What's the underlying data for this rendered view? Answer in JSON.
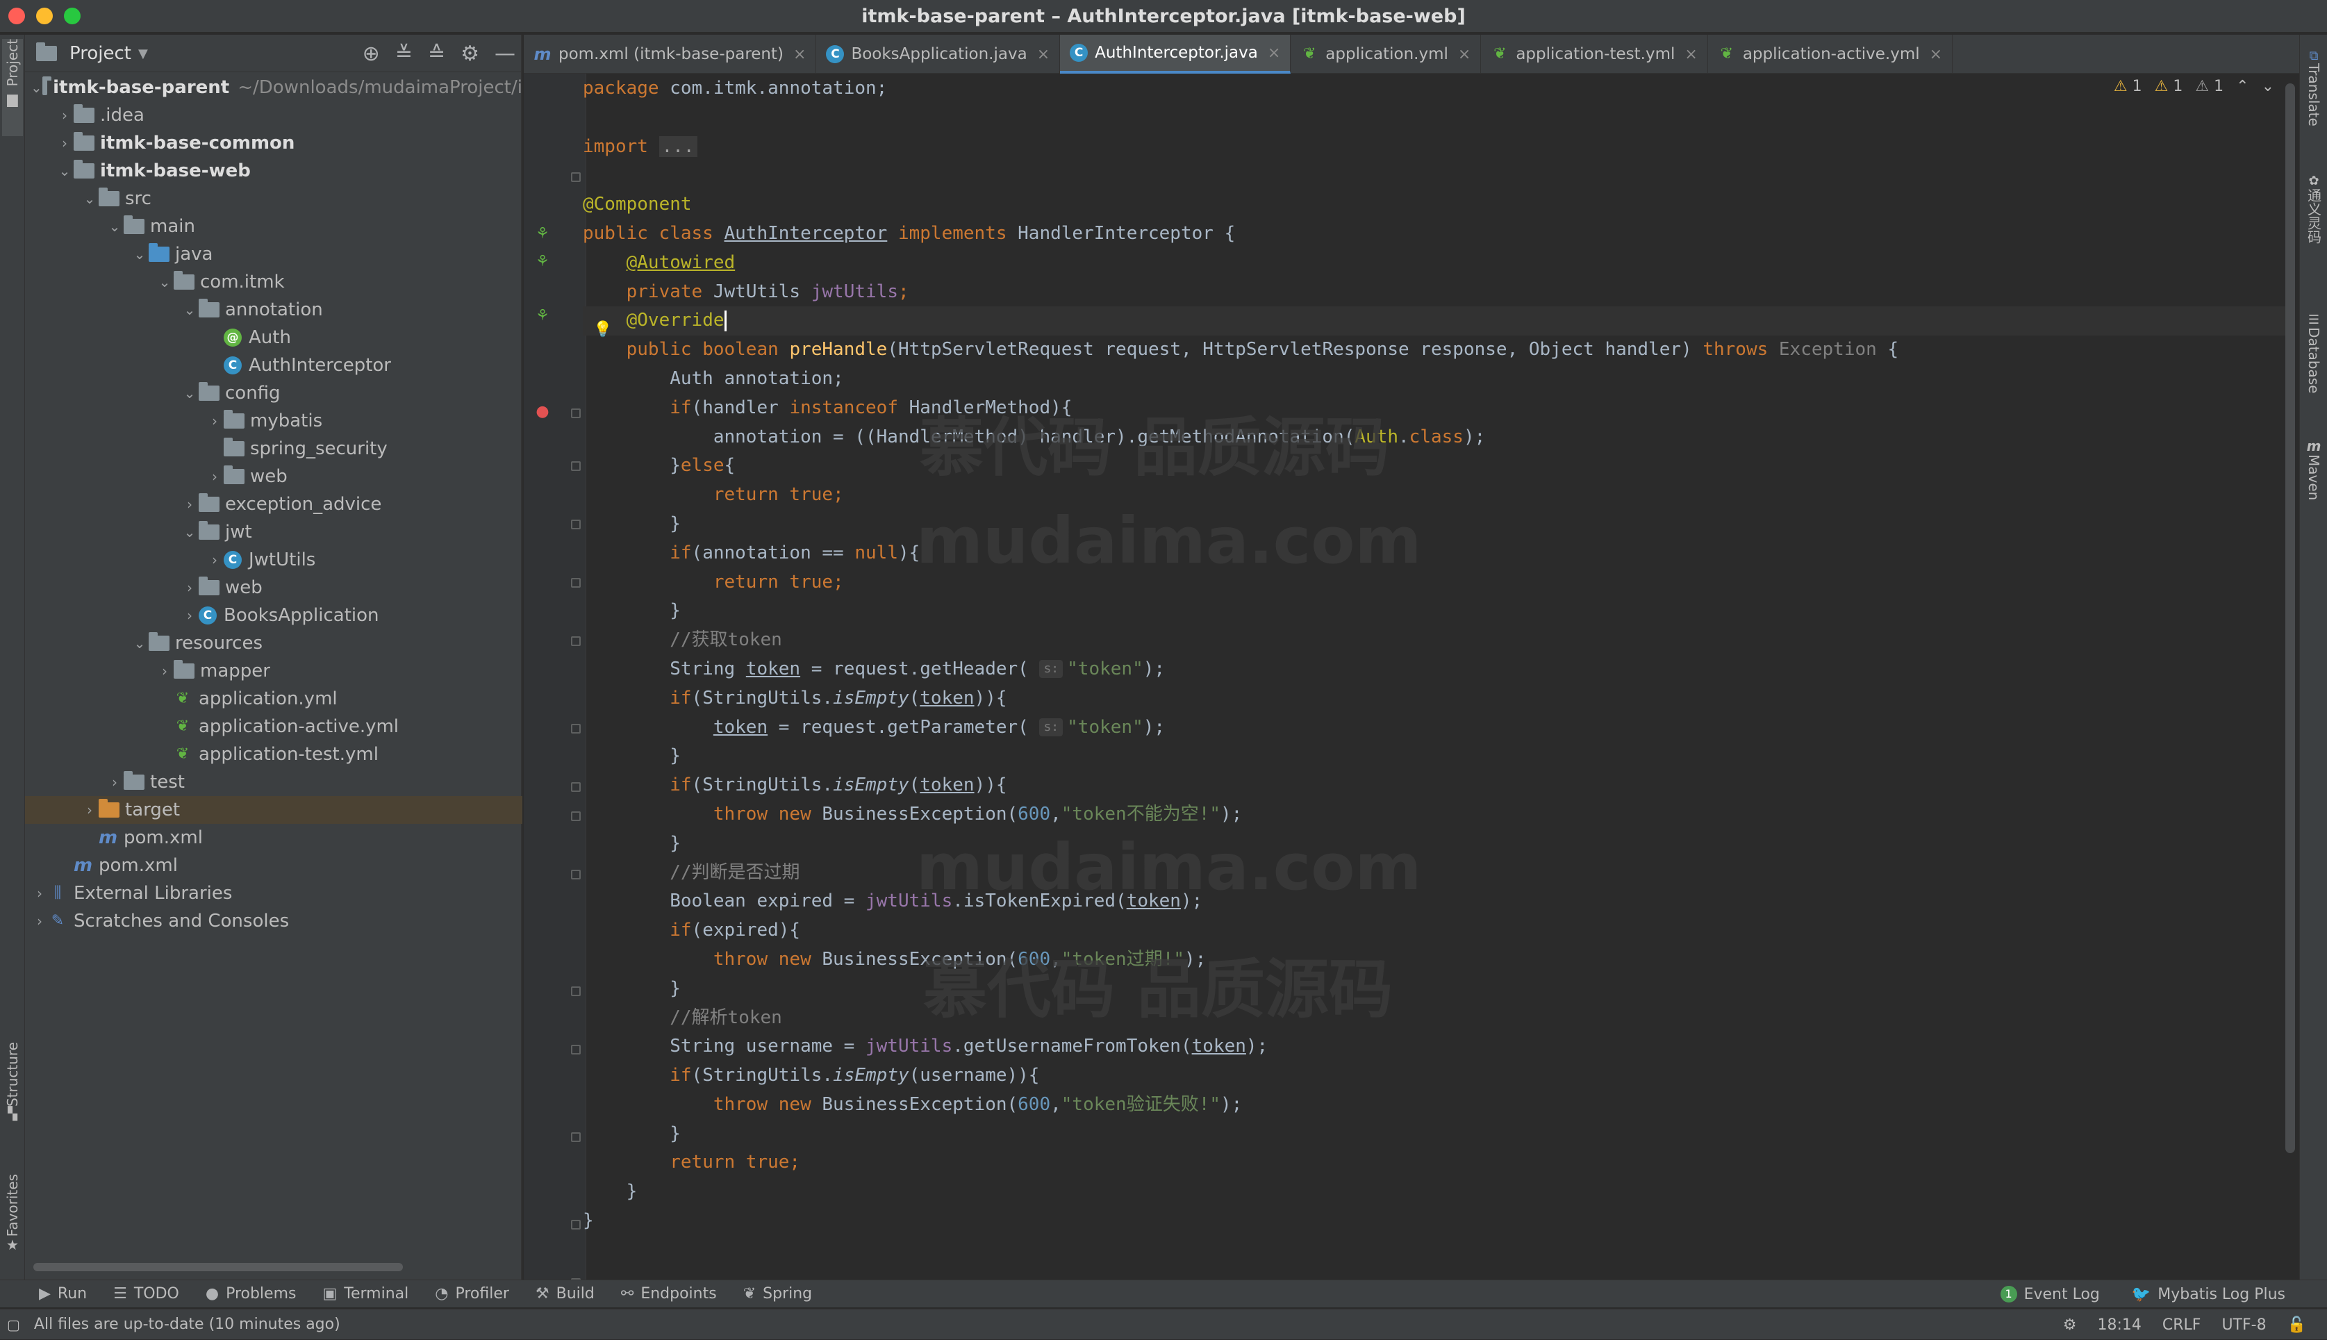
{
  "window": {
    "title": "itmk-base-parent – AuthInterceptor.java [itmk-base-web]",
    "traffic_colors": [
      "#ff5f57",
      "#febc2e",
      "#28c840"
    ]
  },
  "left_strip": {
    "project_label": "Project",
    "structure_label": "Structure",
    "favorites_label": "Favorites"
  },
  "right_strip": {
    "translate_label": "Translate",
    "tongyi_label": "通义灵码",
    "database_label": "Database",
    "maven_label": "Maven"
  },
  "project_panel": {
    "title": "Project",
    "items": [
      {
        "label": "itmk-base-parent",
        "hint": "~/Downloads/mudaimaProject/i",
        "bold": true,
        "depth": 0,
        "chev": "down",
        "kind": "module"
      },
      {
        "label": ".idea",
        "depth": 1,
        "chev": "right",
        "kind": "folder"
      },
      {
        "label": "itmk-base-common",
        "bold": true,
        "depth": 1,
        "chev": "right",
        "kind": "module"
      },
      {
        "label": "itmk-base-web",
        "bold": true,
        "depth": 1,
        "chev": "down",
        "kind": "module"
      },
      {
        "label": "src",
        "depth": 2,
        "chev": "down",
        "kind": "folder"
      },
      {
        "label": "main",
        "depth": 3,
        "chev": "down",
        "kind": "folder"
      },
      {
        "label": "java",
        "depth": 4,
        "chev": "down",
        "kind": "folder-blue"
      },
      {
        "label": "com.itmk",
        "depth": 5,
        "chev": "down",
        "kind": "folder"
      },
      {
        "label": "annotation",
        "depth": 6,
        "chev": "down",
        "kind": "folder"
      },
      {
        "label": "Auth",
        "depth": 7,
        "chev": "none",
        "kind": "annotation"
      },
      {
        "label": "AuthInterceptor",
        "depth": 7,
        "chev": "none",
        "kind": "class"
      },
      {
        "label": "config",
        "depth": 6,
        "chev": "down",
        "kind": "folder"
      },
      {
        "label": "mybatis",
        "depth": 7,
        "chev": "right",
        "kind": "folder"
      },
      {
        "label": "spring_security",
        "depth": 7,
        "chev": "none",
        "kind": "folder"
      },
      {
        "label": "web",
        "depth": 7,
        "chev": "right",
        "kind": "folder"
      },
      {
        "label": "exception_advice",
        "depth": 6,
        "chev": "right",
        "kind": "folder"
      },
      {
        "label": "jwt",
        "depth": 6,
        "chev": "down",
        "kind": "folder"
      },
      {
        "label": "JwtUtils",
        "depth": 7,
        "chev": "right",
        "kind": "class"
      },
      {
        "label": "web",
        "depth": 6,
        "chev": "right",
        "kind": "folder"
      },
      {
        "label": "BooksApplication",
        "depth": 6,
        "chev": "right",
        "kind": "boot"
      },
      {
        "label": "resources",
        "depth": 4,
        "chev": "down",
        "kind": "folder"
      },
      {
        "label": "mapper",
        "depth": 5,
        "chev": "right",
        "kind": "folder"
      },
      {
        "label": "application.yml",
        "depth": 5,
        "chev": "none",
        "kind": "yml"
      },
      {
        "label": "application-active.yml",
        "depth": 5,
        "chev": "none",
        "kind": "yml"
      },
      {
        "label": "application-test.yml",
        "depth": 5,
        "chev": "none",
        "kind": "yml"
      },
      {
        "label": "test",
        "depth": 3,
        "chev": "right",
        "kind": "folder"
      },
      {
        "label": "target",
        "depth": 2,
        "chev": "right",
        "kind": "folder-orange",
        "selected": true
      },
      {
        "label": "pom.xml",
        "depth": 2,
        "chev": "none",
        "kind": "maven"
      },
      {
        "label": "pom.xml",
        "depth": 1,
        "chev": "none",
        "kind": "maven"
      },
      {
        "label": "External Libraries",
        "depth": 0,
        "chev": "right",
        "kind": "libs"
      },
      {
        "label": "Scratches and Consoles",
        "depth": 0,
        "chev": "right",
        "kind": "scratch"
      }
    ]
  },
  "tabs": [
    {
      "label": "pom.xml (itmk-base-parent)",
      "icon": "maven",
      "active": false
    },
    {
      "label": "BooksApplication.java",
      "icon": "boot",
      "active": false
    },
    {
      "label": "AuthInterceptor.java",
      "icon": "class",
      "active": true
    },
    {
      "label": "application.yml",
      "icon": "yml",
      "active": false
    },
    {
      "label": "application-test.yml",
      "icon": "yml",
      "active": false
    },
    {
      "label": "application-active.yml",
      "icon": "yml",
      "active": false
    }
  ],
  "inspections": {
    "warn1": "1",
    "warn2": "1",
    "weak": "1"
  },
  "code_lines": [
    [
      [
        "kw",
        "package "
      ],
      [
        "t",
        "com.itmk.annotation;"
      ]
    ],
    [],
    [
      [
        "kw",
        "import "
      ],
      [
        "fold",
        "..."
      ]
    ],
    [],
    [
      [
        "an",
        "@Component"
      ]
    ],
    [
      [
        "kw",
        "public class "
      ],
      [
        "und",
        "AuthInterceptor"
      ],
      [
        "kw",
        " implements "
      ],
      [
        "t",
        "HandlerInterceptor {"
      ]
    ],
    [
      [
        "t",
        "    "
      ],
      [
        "an und",
        "@Autowired"
      ]
    ],
    [
      [
        "t",
        "    "
      ],
      [
        "kw",
        "private "
      ],
      [
        "t",
        "JwtUtils "
      ],
      [
        "fld",
        "jwtUtils"
      ],
      [
        "kw",
        ";"
      ]
    ],
    [
      [
        "t",
        "    "
      ],
      [
        "an",
        "@Override"
      ],
      [
        "caret",
        ""
      ]
    ],
    [
      [
        "t",
        "    "
      ],
      [
        "kw",
        "public boolean "
      ],
      [
        "mth",
        "preHandle"
      ],
      [
        "t",
        "(HttpServletRequest request, HttpServletResponse response, Object handler) "
      ],
      [
        "kw",
        "throws "
      ],
      [
        "cm",
        "Exception"
      ],
      [
        "t",
        " {"
      ]
    ],
    [
      [
        "t",
        "        Auth annotation;"
      ]
    ],
    [
      [
        "t",
        "        "
      ],
      [
        "kw",
        "if"
      ],
      [
        "t",
        "(handler "
      ],
      [
        "kw",
        "instanceof "
      ],
      [
        "t",
        "HandlerMethod){"
      ]
    ],
    [
      [
        "t",
        "            annotation = ((HandlerMethod) handler).getMethodAnnotation("
      ],
      [
        "an",
        "Auth"
      ],
      [
        "t",
        "."
      ],
      [
        "kw",
        "class"
      ],
      [
        "t",
        ");"
      ]
    ],
    [
      [
        "t",
        "        }"
      ],
      [
        "kw",
        "else"
      ],
      [
        "t",
        "{"
      ]
    ],
    [
      [
        "t",
        "            "
      ],
      [
        "kw",
        "return true;"
      ]
    ],
    [
      [
        "t",
        "        }"
      ]
    ],
    [
      [
        "t",
        "        "
      ],
      [
        "kw",
        "if"
      ],
      [
        "t",
        "(annotation == "
      ],
      [
        "kw",
        "null"
      ],
      [
        "t",
        "){"
      ]
    ],
    [
      [
        "t",
        "            "
      ],
      [
        "kw",
        "return true;"
      ]
    ],
    [
      [
        "t",
        "        }"
      ]
    ],
    [
      [
        "t",
        "        "
      ],
      [
        "cm",
        "//获取token"
      ]
    ],
    [
      [
        "t",
        "        String "
      ],
      [
        "und",
        "token"
      ],
      [
        "t",
        " = request.getHeader( "
      ],
      [
        "pill",
        "s:"
      ],
      [
        "str",
        "\"token\""
      ],
      [
        "t",
        ");"
      ]
    ],
    [
      [
        "t",
        "        "
      ],
      [
        "kw",
        "if"
      ],
      [
        "t",
        "(StringUtils."
      ],
      [
        "ital",
        "isEmpty"
      ],
      [
        "t",
        "("
      ],
      [
        "und",
        "token"
      ],
      [
        "t",
        ")){"
      ]
    ],
    [
      [
        "t",
        "            "
      ],
      [
        "und",
        "token"
      ],
      [
        "t",
        " = request.getParameter( "
      ],
      [
        "pill",
        "s:"
      ],
      [
        "str",
        "\"token\""
      ],
      [
        "t",
        ");"
      ]
    ],
    [
      [
        "t",
        "        }"
      ]
    ],
    [
      [
        "t",
        "        "
      ],
      [
        "kw",
        "if"
      ],
      [
        "t",
        "(StringUtils."
      ],
      [
        "ital",
        "isEmpty"
      ],
      [
        "t",
        "("
      ],
      [
        "und",
        "token"
      ],
      [
        "t",
        ")){"
      ]
    ],
    [
      [
        "t",
        "            "
      ],
      [
        "kw",
        "throw new "
      ],
      [
        "t",
        "BusinessException("
      ],
      [
        "num",
        "600"
      ],
      [
        "t",
        ","
      ],
      [
        "str",
        "\"token不能为空!\""
      ],
      [
        "t",
        ");"
      ]
    ],
    [
      [
        "t",
        "        }"
      ]
    ],
    [
      [
        "t",
        "        "
      ],
      [
        "cm",
        "//判断是否过期"
      ]
    ],
    [
      [
        "t",
        "        Boolean expired = "
      ],
      [
        "fld",
        "jwtUtils"
      ],
      [
        "t",
        ".isTokenExpired("
      ],
      [
        "und",
        "token"
      ],
      [
        "t",
        ");"
      ]
    ],
    [
      [
        "t",
        "        "
      ],
      [
        "kw",
        "if"
      ],
      [
        "t",
        "(expired){"
      ]
    ],
    [
      [
        "t",
        "            "
      ],
      [
        "kw",
        "throw new "
      ],
      [
        "t",
        "BusinessException("
      ],
      [
        "num",
        "600"
      ],
      [
        "t",
        ","
      ],
      [
        "str",
        "\"token过期!\""
      ],
      [
        "t",
        ");"
      ]
    ],
    [
      [
        "t",
        "        }"
      ]
    ],
    [
      [
        "t",
        "        "
      ],
      [
        "cm",
        "//解析token"
      ]
    ],
    [
      [
        "t",
        "        String username = "
      ],
      [
        "fld",
        "jwtUtils"
      ],
      [
        "t",
        ".getUsernameFromToken("
      ],
      [
        "und",
        "token"
      ],
      [
        "t",
        ");"
      ]
    ],
    [
      [
        "t",
        "        "
      ],
      [
        "kw",
        "if"
      ],
      [
        "t",
        "(StringUtils."
      ],
      [
        "ital",
        "isEmpty"
      ],
      [
        "t",
        "(username)){"
      ]
    ],
    [
      [
        "t",
        "            "
      ],
      [
        "kw",
        "throw new "
      ],
      [
        "t",
        "BusinessException("
      ],
      [
        "num",
        "600"
      ],
      [
        "t",
        ","
      ],
      [
        "str",
        "\"token验证失败!\""
      ],
      [
        "t",
        ");"
      ]
    ],
    [
      [
        "t",
        "        }"
      ]
    ],
    [
      [
        "t",
        "        "
      ],
      [
        "kw",
        "return true;"
      ]
    ],
    [
      [
        "t",
        "    }"
      ]
    ],
    [
      [
        "t",
        "}"
      ]
    ]
  ],
  "watermarks": [
    "慕代码 品质源码",
    "mudaima.com",
    "mudaima.com",
    "慕代码 品质源码"
  ],
  "bottom_tools": {
    "run": "Run",
    "todo": "TODO",
    "problems": "Problems",
    "terminal": "Terminal",
    "profiler": "Profiler",
    "build": "Build",
    "endpoints": "Endpoints",
    "spring": "Spring",
    "event_log": "Event Log",
    "event_count": "1",
    "mybatis": "Mybatis Log Plus"
  },
  "status": {
    "message": "All files are up-to-date (10 minutes ago)",
    "position": "18:14",
    "line_sep": "CRLF",
    "encoding": "UTF-8"
  }
}
